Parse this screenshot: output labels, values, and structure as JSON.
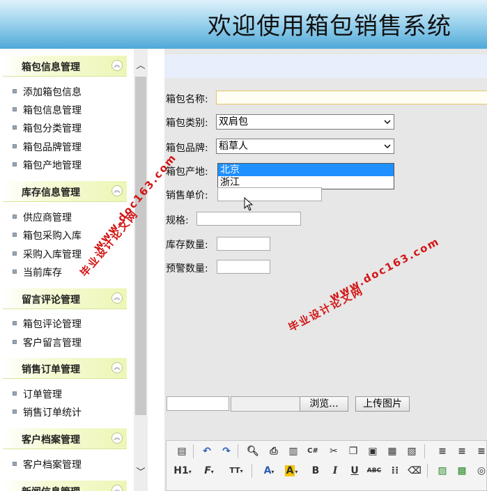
{
  "header": {
    "title": "欢迎使用箱包销售系统"
  },
  "sidebar": {
    "groups": [
      {
        "title": "箱包信息管理",
        "items": [
          "添加箱包信息",
          "箱包信息管理",
          "箱包分类管理",
          "箱包品牌管理",
          "箱包产地管理"
        ]
      },
      {
        "title": "库存信息管理",
        "items": [
          "供应商管理",
          "箱包采购入库",
          "采购入库管理",
          "当前库存"
        ]
      },
      {
        "title": "留言评论管理",
        "items": [
          "箱包评论管理",
          "客户留言管理"
        ]
      },
      {
        "title": "销售订单管理",
        "items": [
          "订单管理",
          "销售订单统计"
        ]
      },
      {
        "title": "客户档案管理",
        "items": [
          "客户档案管理"
        ]
      },
      {
        "title": "新闻信息管理",
        "items": []
      }
    ],
    "collapse_icon": "double-chevron-up-icon"
  },
  "form": {
    "name_label": "箱包名称:",
    "category_label": "箱包类别:",
    "category_value": "双肩包",
    "brand_label": "箱包品牌:",
    "brand_value": "稻草人",
    "origin_label": "箱包产地:",
    "origin_options": [
      "北京",
      "浙江"
    ],
    "origin_selected": "北京",
    "price_label": "销售单价:",
    "spec_label": "规格:",
    "stock_label": "库存数量:",
    "warn_label": "预警数量:",
    "browse_button": "浏览...",
    "upload_button": "上传图片"
  },
  "editor": {
    "heading_tool": "H1",
    "font_tool": "F",
    "size_tool": "TT",
    "color_tool": "A",
    "highlight_tool": "A",
    "bold": "B",
    "italic": "I",
    "underline": "U",
    "strike": "ABC"
  },
  "watermarks": [
    "毕业设计论文网",
    "www.doc163.com"
  ],
  "colors": {
    "header_accent": "#4fa9d8",
    "menu_group_bg": "#eef6b6",
    "watermark": "#d31616",
    "selection": "#1e90ff"
  }
}
